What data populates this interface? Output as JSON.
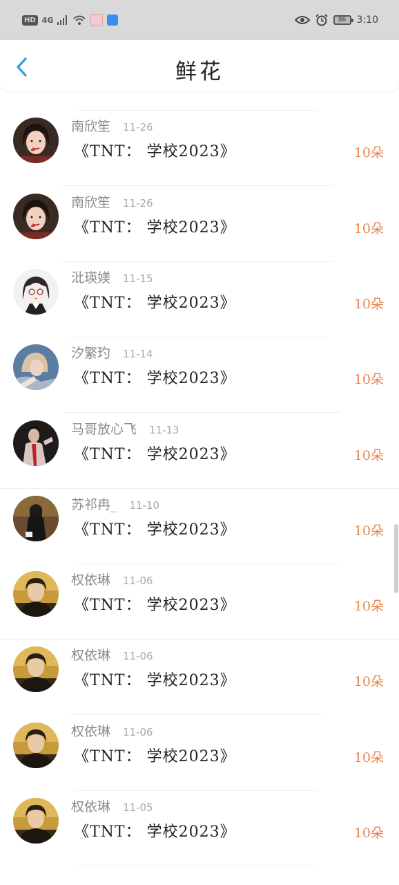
{
  "status_bar": {
    "hd": "HD",
    "signal": "4G",
    "battery": "86",
    "time": "3:10"
  },
  "nav": {
    "title": "鲜花"
  },
  "rows": [
    {
      "name": "",
      "date": "",
      "gift": "《TNT： 学校2023》",
      "count": "10朵",
      "avatar": "girl-glasses"
    },
    {
      "name": "南欣笙",
      "date": "11-26",
      "gift": "《TNT： 学校2023》",
      "count": "10朵",
      "avatar": "girl-red"
    },
    {
      "name": "南欣笙",
      "date": "11-26",
      "gift": "《TNT： 学校2023》",
      "count": "10朵",
      "avatar": "girl-red"
    },
    {
      "name": "沘瑛媄",
      "date": "11-15",
      "gift": "《TNT： 学校2023》",
      "count": "10朵",
      "avatar": "girl-glasses"
    },
    {
      "name": "汐繁玓",
      "date": "11-14",
      "gift": "《TNT： 学校2023》",
      "count": "10朵",
      "avatar": "girl-blonde"
    },
    {
      "name": "马哥放心飞",
      "date": "11-13",
      "gift": "《TNT： 学校2023》",
      "count": "10朵",
      "avatar": "man-coat"
    },
    {
      "name": "苏祁冉_",
      "date": "11-10",
      "gift": "《TNT： 学校2023》",
      "count": "10朵",
      "avatar": "girl-dark"
    },
    {
      "name": "权依琳",
      "date": "11-06",
      "gift": "《TNT： 学校2023》",
      "count": "10朵",
      "avatar": "boy-gold"
    },
    {
      "name": "权依琳",
      "date": "11-06",
      "gift": "《TNT： 学校2023》",
      "count": "10朵",
      "avatar": "boy-gold"
    },
    {
      "name": "权依琳",
      "date": "11-06",
      "gift": "《TNT： 学校2023》",
      "count": "10朵",
      "avatar": "boy-gold"
    },
    {
      "name": "权依琳",
      "date": "11-05",
      "gift": "《TNT： 学校2023》",
      "count": "10朵",
      "avatar": "boy-gold"
    }
  ],
  "colors": {
    "accent_blue": "#2f9be6",
    "flower_orange": "#e8844a"
  }
}
